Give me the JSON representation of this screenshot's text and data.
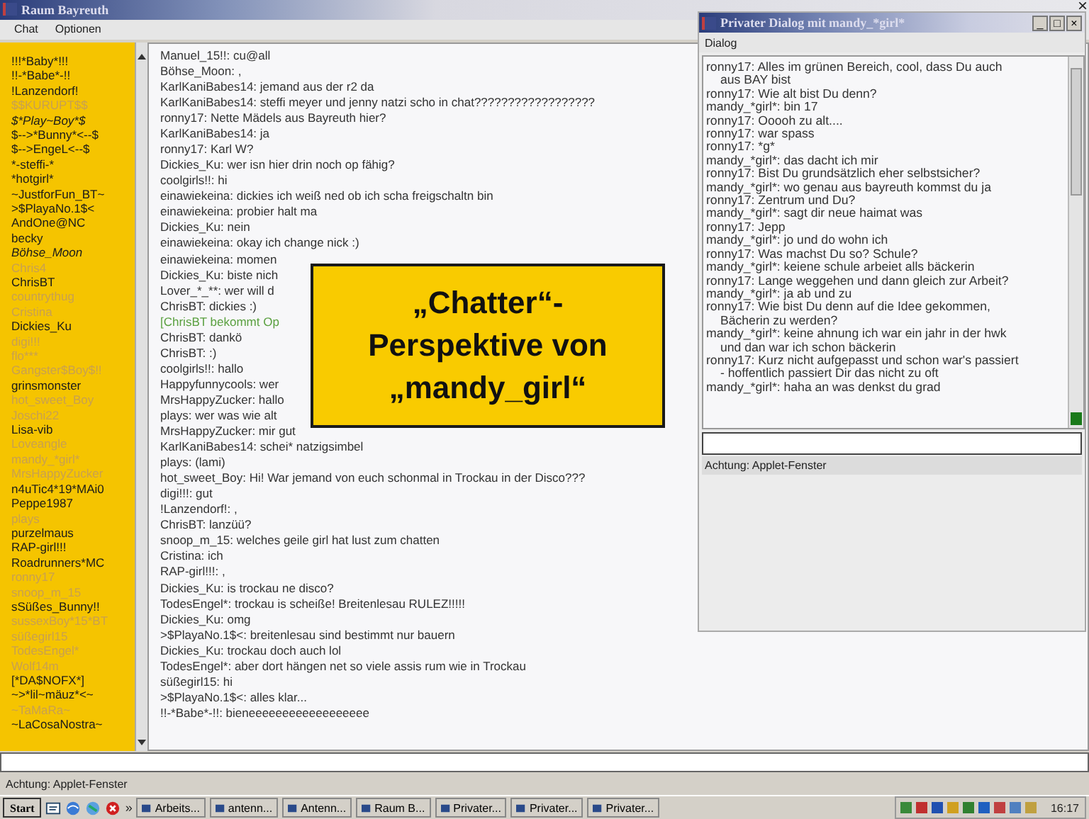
{
  "main_window": {
    "title": "Raum Bayreuth",
    "close": "×",
    "menu": [
      "Chat",
      "Optionen"
    ],
    "users": [
      {
        "name": "!!!*Baby*!!!",
        "kind": "normal"
      },
      {
        "name": "!!-*Babe*-!!",
        "kind": "normal"
      },
      {
        "name": "!Lanzendorf!",
        "kind": "normal"
      },
      {
        "name": "$$KURUPT$$",
        "kind": "dimmed"
      },
      {
        "name": "$*Play~Boy*$",
        "kind": "italic"
      },
      {
        "name": "$-->*Bunny*<--$",
        "kind": "normal"
      },
      {
        "name": "$-->EngeL<--$",
        "kind": "normal"
      },
      {
        "name": "*-steffi-*",
        "kind": "normal"
      },
      {
        "name": "*hotgirl*",
        "kind": "normal"
      },
      {
        "name": "~JustforFun_BT~",
        "kind": "normal"
      },
      {
        "name": ">$PlayaNo.1$<",
        "kind": "normal"
      },
      {
        "name": "AndOne@NC",
        "kind": "normal"
      },
      {
        "name": "becky",
        "kind": "normal"
      },
      {
        "name": "Böhse_Moon",
        "kind": "italic"
      },
      {
        "name": "Chris4",
        "kind": "dimmed"
      },
      {
        "name": "ChrisBT",
        "kind": "normal"
      },
      {
        "name": "countrythug",
        "kind": "dimmed"
      },
      {
        "name": "Cristina",
        "kind": "dimmed"
      },
      {
        "name": "Dickies_Ku",
        "kind": "normal"
      },
      {
        "name": "digi!!!",
        "kind": "dimmed"
      },
      {
        "name": "flo***",
        "kind": "dimmed"
      },
      {
        "name": "Gangster$Boy$!!",
        "kind": "dimmed"
      },
      {
        "name": "grinsmonster",
        "kind": "normal"
      },
      {
        "name": "hot_sweet_Boy",
        "kind": "dimmed"
      },
      {
        "name": "Joschi22",
        "kind": "dimmed"
      },
      {
        "name": "Lisa-vib",
        "kind": "normal"
      },
      {
        "name": "Loveangle",
        "kind": "dimmed"
      },
      {
        "name": "mandy_*girl*",
        "kind": "dimmed"
      },
      {
        "name": "MrsHappyZucker",
        "kind": "dimmed"
      },
      {
        "name": "n4uTic4*19*MAi0",
        "kind": "normal"
      },
      {
        "name": "Peppe1987",
        "kind": "normal"
      },
      {
        "name": "plays",
        "kind": "dimmed"
      },
      {
        "name": "purzelmaus",
        "kind": "normal"
      },
      {
        "name": "RAP-girl!!!",
        "kind": "normal"
      },
      {
        "name": "Roadrunners*MC",
        "kind": "normal"
      },
      {
        "name": "ronny17",
        "kind": "dimmed"
      },
      {
        "name": "snoop_m_15",
        "kind": "dimmed"
      },
      {
        "name": "sSüßes_Bunny!!",
        "kind": "normal"
      },
      {
        "name": "sussexBoy*15*BT",
        "kind": "dimmed"
      },
      {
        "name": "süßegirl15",
        "kind": "dimmed"
      },
      {
        "name": "TodesEngel*",
        "kind": "dimmed"
      },
      {
        "name": "Wolf14m",
        "kind": "dimmed"
      },
      {
        "name": "[*DA$NOFX*]",
        "kind": "normal"
      },
      {
        "name": "~>*lil~mäuz*<~",
        "kind": "normal"
      },
      {
        "name": "~TaMaRa~",
        "kind": "dimmed"
      },
      {
        "name": "~LaCosaNostra~",
        "kind": "normal"
      }
    ],
    "messages": [
      {
        "text": "Manuel_15!!: cu@all",
        "kind": "message"
      },
      {
        "text": "Böhse_Moon: ,",
        "kind": "message"
      },
      {
        "text": "KarlKaniBabes14: jemand aus der r2 da",
        "kind": "message"
      },
      {
        "text": "KarlKaniBabes14: steffi meyer und jenny natzi scho in chat??????????????????",
        "kind": "message"
      },
      {
        "text": "ronny17: Nette Mädels aus Bayreuth hier?",
        "kind": "message"
      },
      {
        "text": "KarlKaniBabes14: ja",
        "kind": "message"
      },
      {
        "text": "ronny17: Karl W?",
        "kind": "message"
      },
      {
        "text": "Dickies_Ku: wer isn hier drin noch op fähig?",
        "kind": "message"
      },
      {
        "text": "coolgirls!!: hi",
        "kind": "message"
      },
      {
        "text": "einawiekeina: dickies ich weiß ned ob ich scha freigschaltn bin",
        "kind": "message"
      },
      {
        "text": "einawiekeina: probier halt ma",
        "kind": "message"
      },
      {
        "text": "Dickies_Ku: nein",
        "kind": "message"
      },
      {
        "text": "einawiekeina: okay ich change nick :)",
        "kind": "message"
      },
      {
        "text": "einawiekeina: momen",
        "kind": "message"
      },
      {
        "text": "Dickies_Ku: biste nich",
        "kind": "message"
      },
      {
        "text": "Lover_*_**: wer will d",
        "kind": "message"
      },
      {
        "text": "ChrisBT: dickies :)",
        "kind": "message"
      },
      {
        "text": "[ChrisBT bekommt Op",
        "kind": "system"
      },
      {
        "text": "ChrisBT: dankö",
        "kind": "message"
      },
      {
        "text": "ChrisBT: :)",
        "kind": "message"
      },
      {
        "text": "coolgirls!!: hallo",
        "kind": "message"
      },
      {
        "text": "Happyfunnycools: wer",
        "kind": "message"
      },
      {
        "text": "MrsHappyZucker: hallo",
        "kind": "message"
      },
      {
        "text": "plays: wer was wie alt",
        "kind": "message"
      },
      {
        "text": "MrsHappyZucker: mir gut",
        "kind": "message"
      },
      {
        "text": "KarlKaniBabes14: schei* natzigsimbel",
        "kind": "message"
      },
      {
        "text": "plays: (lami)",
        "kind": "message"
      },
      {
        "text": "hot_sweet_Boy: Hi! War jemand von euch schonmal in Trockau in der Disco???",
        "kind": "message"
      },
      {
        "text": "digi!!!: gut",
        "kind": "message"
      },
      {
        "text": "!Lanzendorf!: ,",
        "kind": "message"
      },
      {
        "text": "ChrisBT: lanzüü?",
        "kind": "message"
      },
      {
        "text": "snoop_m_15: welches geile girl hat lust zum chatten",
        "kind": "message"
      },
      {
        "text": "Cristina: ich",
        "kind": "message"
      },
      {
        "text": "RAP-girl!!!: ,",
        "kind": "message"
      },
      {
        "text": "Dickies_Ku: is trockau ne disco?",
        "kind": "message"
      },
      {
        "text": "TodesEngel*: trockau is scheiße! Breitenlesau RULEZ!!!!!",
        "kind": "message"
      },
      {
        "text": "Dickies_Ku: omg",
        "kind": "message"
      },
      {
        "text": ">$PlayaNo.1$<: breitenlesau sind bestimmt nur bauern",
        "kind": "message"
      },
      {
        "text": "Dickies_Ku: trockau doch auch lol",
        "kind": "message"
      },
      {
        "text": "TodesEngel*: aber dort hängen net so viele assis rum wie in Trockau",
        "kind": "message"
      },
      {
        "text": "süßegirl15: hi",
        "kind": "message"
      },
      {
        "text": ">$PlayaNo.1$<: alles klar...",
        "kind": "message"
      },
      {
        "text": "!!-*Babe*-!!: bieneeeeeeeeeeeeeeeeee",
        "kind": "message"
      }
    ],
    "status": "Achtung: Applet-Fenster"
  },
  "private_dialog": {
    "title": "Privater Dialog mit mandy_*girl*",
    "controls": [
      "_",
      "□",
      "×"
    ],
    "menu": [
      "Dialog"
    ],
    "messages": [
      "ronny17: Alles im grünen Bereich, cool, dass Du auch aus BAY bist",
      "ronny17: Wie alt bist Du denn?",
      "mandy_*girl*: bin 17",
      "ronny17: Ooooh zu alt....",
      "ronny17: war spass",
      "ronny17: *g*",
      "mandy_*girl*: das dacht ich mir",
      "ronny17: Bist Du grundsätzlich eher selbstsicher?",
      "mandy_*girl*: wo genau aus bayreuth kommst du ja",
      "ronny17: Zentrum und Du?",
      "mandy_*girl*: sagt dir neue haimat was",
      "ronny17: Jepp",
      "mandy_*girl*: jo und do wohn ich",
      "ronny17: Was machst Du so? Schule?",
      "mandy_*girl*: keiene schule arbeiet alls bäckerin",
      "ronny17: Lange weggehen und dann gleich zur Arbeit?",
      "mandy_*girl*: ja ab und zu",
      "ronny17: Wie bist Du denn auf die Idee gekommen, Bächerin zu werden?",
      "mandy_*girl*: keine ahnung ich war ein jahr in der hwk und dan war ich schon bäckerin",
      "ronny17: Kurz nicht aufgepasst und schon war's passiert - hoffentlich passiert Dir das nicht zu oft",
      "mandy_*girl*: haha an was denkst du grad"
    ],
    "status": "Achtung: Applet-Fenster"
  },
  "caption": [
    "„Chatter“-",
    "Perspektive von",
    "„mandy_girl“"
  ],
  "taskbar": {
    "start": "Start",
    "more": "»",
    "tasks": [
      {
        "label": "Arbeits...",
        "selected": false
      },
      {
        "label": "antenn...",
        "selected": false
      },
      {
        "label": "Antenn...",
        "selected": false
      },
      {
        "label": "Raum B...",
        "selected": false
      },
      {
        "label": "Privater...",
        "selected": false
      },
      {
        "label": "Privater...",
        "selected": false
      },
      {
        "label": "Privater...",
        "selected": false
      }
    ],
    "clock": "16:17"
  }
}
